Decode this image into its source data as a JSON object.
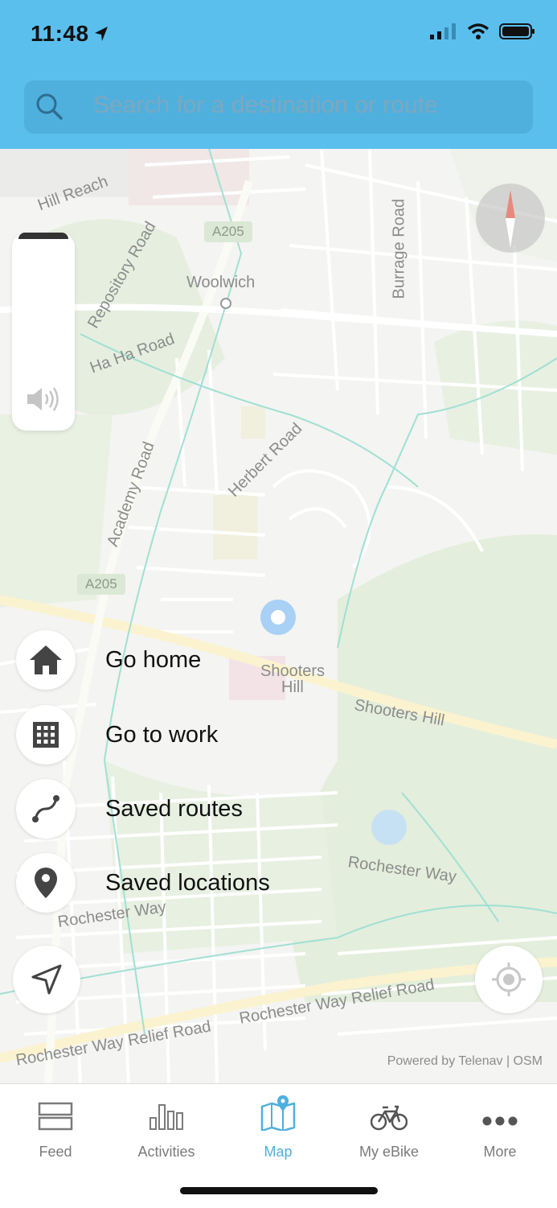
{
  "status_bar": {
    "time": "11:48"
  },
  "search": {
    "placeholder": "Search for a destination or route"
  },
  "map": {
    "place_labels": {
      "hill_reach": "Hill Reach",
      "repository_road": "Repository Road",
      "woolwich": "Woolwich",
      "burrage_road": "Burrage Road",
      "ha_ha_road": "Ha Ha Road",
      "herbert_road": "Herbert Road",
      "academy_road": "Academy Road",
      "shooters_hill_1": "Shooters",
      "shooters_hill_2": "Hill",
      "shooters_hill_road": "Shooters Hill",
      "rochester_way_1": "Rochester Way",
      "rochester_way_2": "Rochester Way",
      "relief_road_1": "Rochester Way Relief Road",
      "relief_road_2": "Rochester Way Relief Road"
    },
    "road_badges": {
      "a205_top": "A205",
      "a205_mid": "A205"
    },
    "attribution": "Powered by Telenav | OSM"
  },
  "quick_actions": [
    {
      "label": "Go home",
      "icon": "home-icon"
    },
    {
      "label": "Go to work",
      "icon": "building-icon"
    },
    {
      "label": "Saved routes",
      "icon": "route-icon"
    },
    {
      "label": "Saved locations",
      "icon": "location-pin-icon"
    }
  ],
  "tabs": [
    {
      "label": "Feed",
      "icon": "feed-icon"
    },
    {
      "label": "Activities",
      "icon": "activities-icon"
    },
    {
      "label": "Map",
      "icon": "map-icon",
      "active": true
    },
    {
      "label": "My eBike",
      "icon": "bike-icon"
    },
    {
      "label": "More",
      "icon": "more-icon"
    }
  ],
  "colors": {
    "header": "#5bbfee",
    "accent": "#4fb0de",
    "user_location": "#a9d0f5"
  }
}
